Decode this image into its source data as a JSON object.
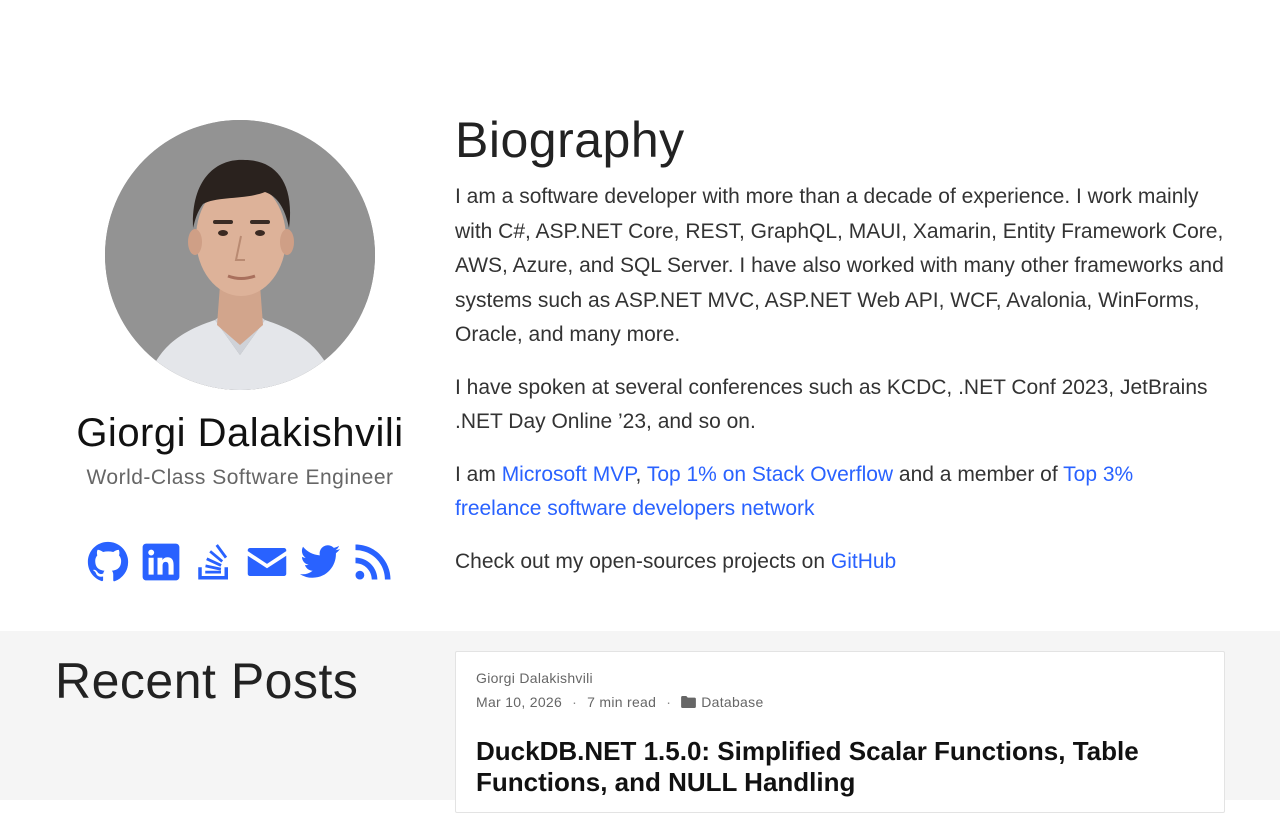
{
  "profile": {
    "name": "Giorgi Dalakishvili",
    "role": "World-Class Software Engineer",
    "social_icons": [
      "github-icon",
      "linkedin-icon",
      "stackexchange-icon",
      "envelope-icon",
      "twitter-icon",
      "rss-icon"
    ]
  },
  "bio": {
    "heading": "Biography",
    "paragraph1": "I am a software developer with more than a decade of experience. I work mainly with C#, ASP.NET Core, REST, GraphQL, MAUI, Xamarin, Entity Framework Core, AWS, Azure, and SQL Server. I have also worked with many other frameworks and systems such as ASP.NET MVC, ASP.NET Web API, WCF, Avalonia, WinForms, Oracle, and many more.",
    "paragraph2": "I have spoken at several conferences such as KCDC, .NET Conf 2023, JetBrains .NET Day Online ’23, and so on.",
    "p3_prefix": "I am ",
    "p3_link1": "Microsoft MVP",
    "p3_sep": ", ",
    "p3_link2": "Top 1% on Stack Overflow",
    "p3_mid": " and a member of ",
    "p3_link3": "Top 3% freelance software developers network",
    "p4_prefix": "Check out my open-sources projects on ",
    "p4_link": "GitHub"
  },
  "posts": {
    "title": "Recent Posts",
    "items": [
      {
        "author": "Giorgi Dalakishvili",
        "date": "Mar 10, 2026",
        "read_time": "7 min read",
        "category": "Database",
        "title": "DuckDB.NET 1.5.0: Simplified Scalar Functions, Table Functions, and NULL Handling"
      }
    ]
  },
  "colors": {
    "link": "#2962ff",
    "posts_bg": "#f5f5f5"
  }
}
